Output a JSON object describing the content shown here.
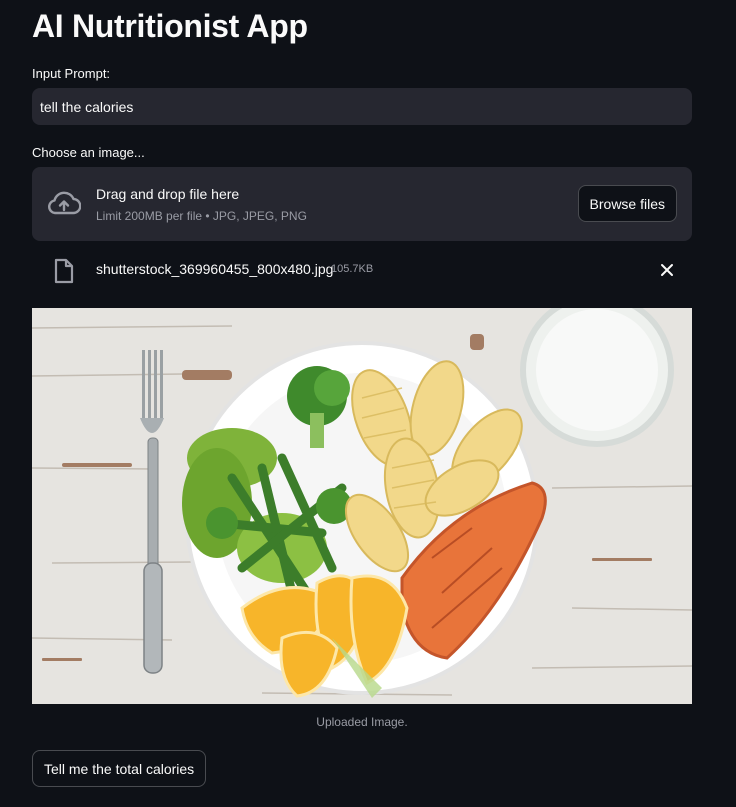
{
  "app": {
    "title": "AI Nutritionist App"
  },
  "prompt": {
    "label": "Input Prompt:",
    "value": "tell the calories"
  },
  "uploader": {
    "label": "Choose an image...",
    "drop_title": "Drag and drop file here",
    "limit_text": "Limit 200MB per file • JPG, JPEG, PNG",
    "browse_label": "Browse files",
    "file": {
      "name": "shutterstock_369960455_800x480.jpg",
      "size": "105.7KB"
    }
  },
  "image": {
    "caption": "Uploaded Image."
  },
  "actions": {
    "submit_label": "Tell me the total calories"
  },
  "icons": {
    "upload": "cloud-upload-icon",
    "file": "file-icon",
    "remove": "close-icon"
  },
  "colors": {
    "background": "#0e1117",
    "widget": "#262730",
    "text": "#fafafa",
    "muted": "#9a9ca5"
  }
}
